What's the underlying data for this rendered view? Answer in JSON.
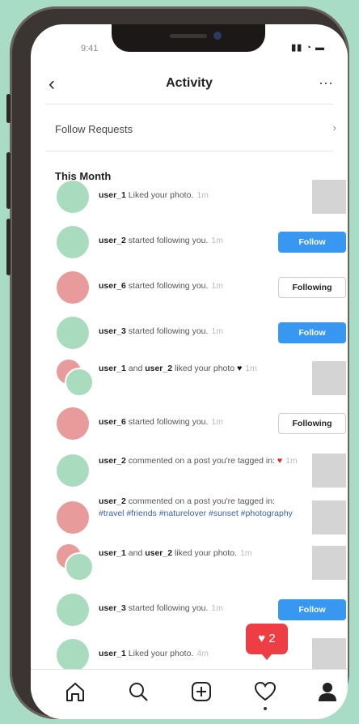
{
  "status": {
    "time": "9:41",
    "icons": "▮▮ ◔ ▬"
  },
  "header": {
    "back_label": "‹",
    "title": "Activity",
    "more_label": "···"
  },
  "follow_requests": {
    "label": "Follow Requests",
    "chevron": "›"
  },
  "section_title": "This Month",
  "buttons": {
    "follow": "Follow",
    "following": "Following"
  },
  "rows": [
    {
      "avatar": "single-green",
      "user": "user_1",
      "text": " Liked your photo.",
      "time": "1m",
      "action": "thumb"
    },
    {
      "avatar": "single-green",
      "user": "user_2",
      "text": " started following you.",
      "time": "1m",
      "action": "follow"
    },
    {
      "avatar": "single-red",
      "user": "user_6",
      "text": " started following you.",
      "time": "1m",
      "action": "following"
    },
    {
      "avatar": "single-green",
      "user": "user_3",
      "text": " started following you.",
      "time": "1m",
      "action": "follow"
    },
    {
      "avatar": "double",
      "user": "user_1",
      "and": " and ",
      "user2": "user_2",
      "text": " liked your photo",
      "suffix": "♥",
      "time": "1m",
      "action": "thumb"
    },
    {
      "avatar": "single-red",
      "user": "user_6",
      "text": " started following you.",
      "time": "1m",
      "action": "following"
    },
    {
      "avatar": "single-green",
      "user": "user_2",
      "text": " commented on a post you're tagged in:",
      "suffix": "♥",
      "time": "1m",
      "action": "thumb"
    },
    {
      "avatar": "single-red",
      "user": "user_2",
      "text": " commented on a post you're tagged in:",
      "tags": "#travel #friends #naturelover #sunset #photography",
      "action": "thumb"
    },
    {
      "avatar": "double",
      "user": "user_1",
      "and": " and ",
      "user2": "user_2",
      "text": " liked your photo.",
      "time": "1m",
      "action": "thumb"
    },
    {
      "avatar": "single-green",
      "user": "user_3",
      "text": " started following you.",
      "time": "1m",
      "action": "follow"
    },
    {
      "avatar": "single-green",
      "user": "user_1",
      "text": " Liked your photo.",
      "time": "4m",
      "action": "thumb"
    }
  ],
  "notification_badge": {
    "icon": "heart-icon",
    "count": "2"
  },
  "tabbar": [
    "home-icon",
    "search-icon",
    "add-icon",
    "heart-icon",
    "profile-icon"
  ],
  "colors": {
    "follow": "#3897f0",
    "badge": "#ed3e43",
    "avatar_green": "#a9dbbf",
    "avatar_red": "#e79b9b"
  }
}
